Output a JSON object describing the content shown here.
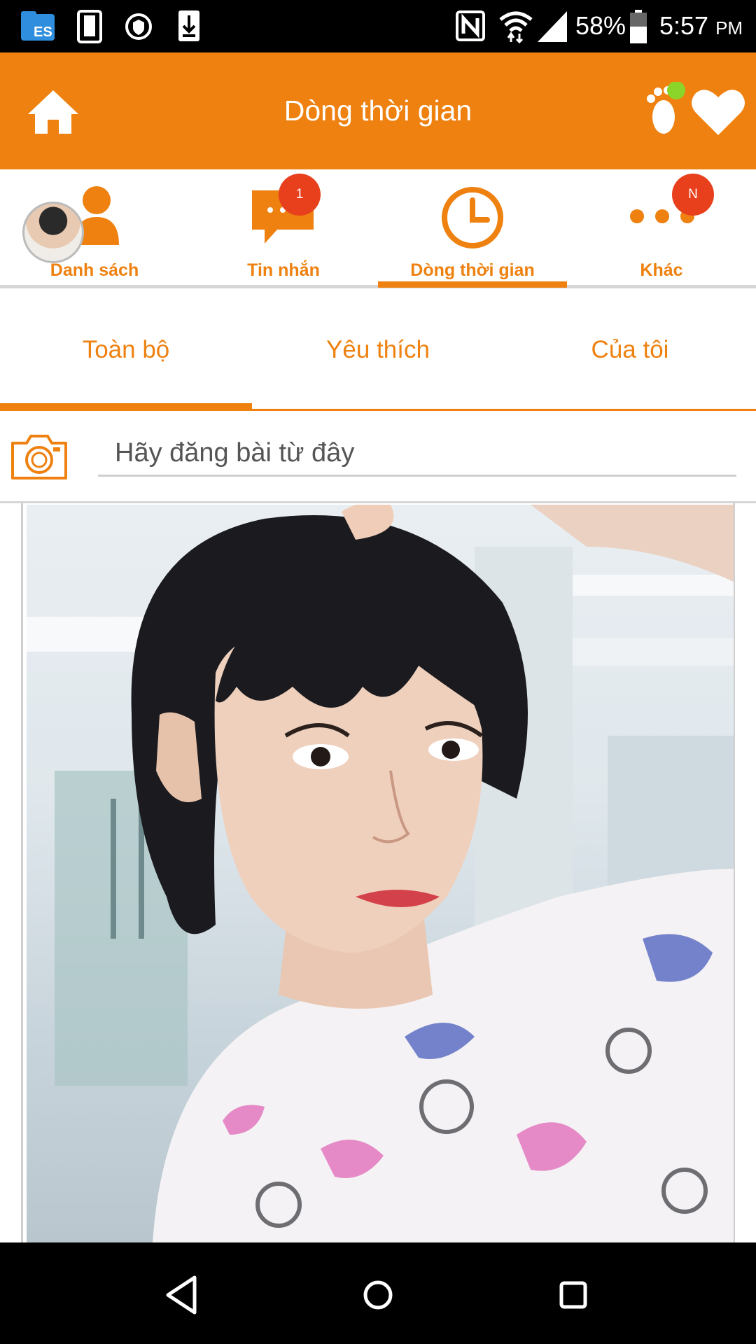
{
  "status_bar": {
    "battery": "58%",
    "time": "5:57",
    "ampm": "PM",
    "icons": [
      "file-manager-icon",
      "phone-icon",
      "vpn-shield-icon",
      "download-icon",
      "nfc-icon",
      "wifi-icon",
      "signal-icon",
      "battery-icon"
    ]
  },
  "app_bar": {
    "title": "Dòng thời gian",
    "left_icon": "home-icon",
    "right_icons": [
      "footprint-icon",
      "heart-icon"
    ],
    "notification_dot_color": "#8bd42a"
  },
  "nav_tabs": [
    {
      "label": "Danh sách",
      "icon": "contacts-icon",
      "badge": ""
    },
    {
      "label": "Tin nhắn",
      "icon": "chat-icon",
      "badge": "1"
    },
    {
      "label": "Dòng thời gian",
      "icon": "clock-icon",
      "badge": "",
      "active": true
    },
    {
      "label": "Khác",
      "icon": "more-dots-icon",
      "badge": "N"
    }
  ],
  "filter_tabs": [
    {
      "label": "Toàn bộ",
      "active": true
    },
    {
      "label": "Yêu thích",
      "active": false
    },
    {
      "label": "Của tôi",
      "active": false
    }
  ],
  "post_bar": {
    "placeholder": "Hãy đăng bài từ đây",
    "icon": "camera-icon"
  },
  "theme": {
    "accent": "#ee8110",
    "badge": "#e8401c"
  },
  "system_nav": [
    "back-icon",
    "home-circle-icon",
    "recents-icon"
  ]
}
